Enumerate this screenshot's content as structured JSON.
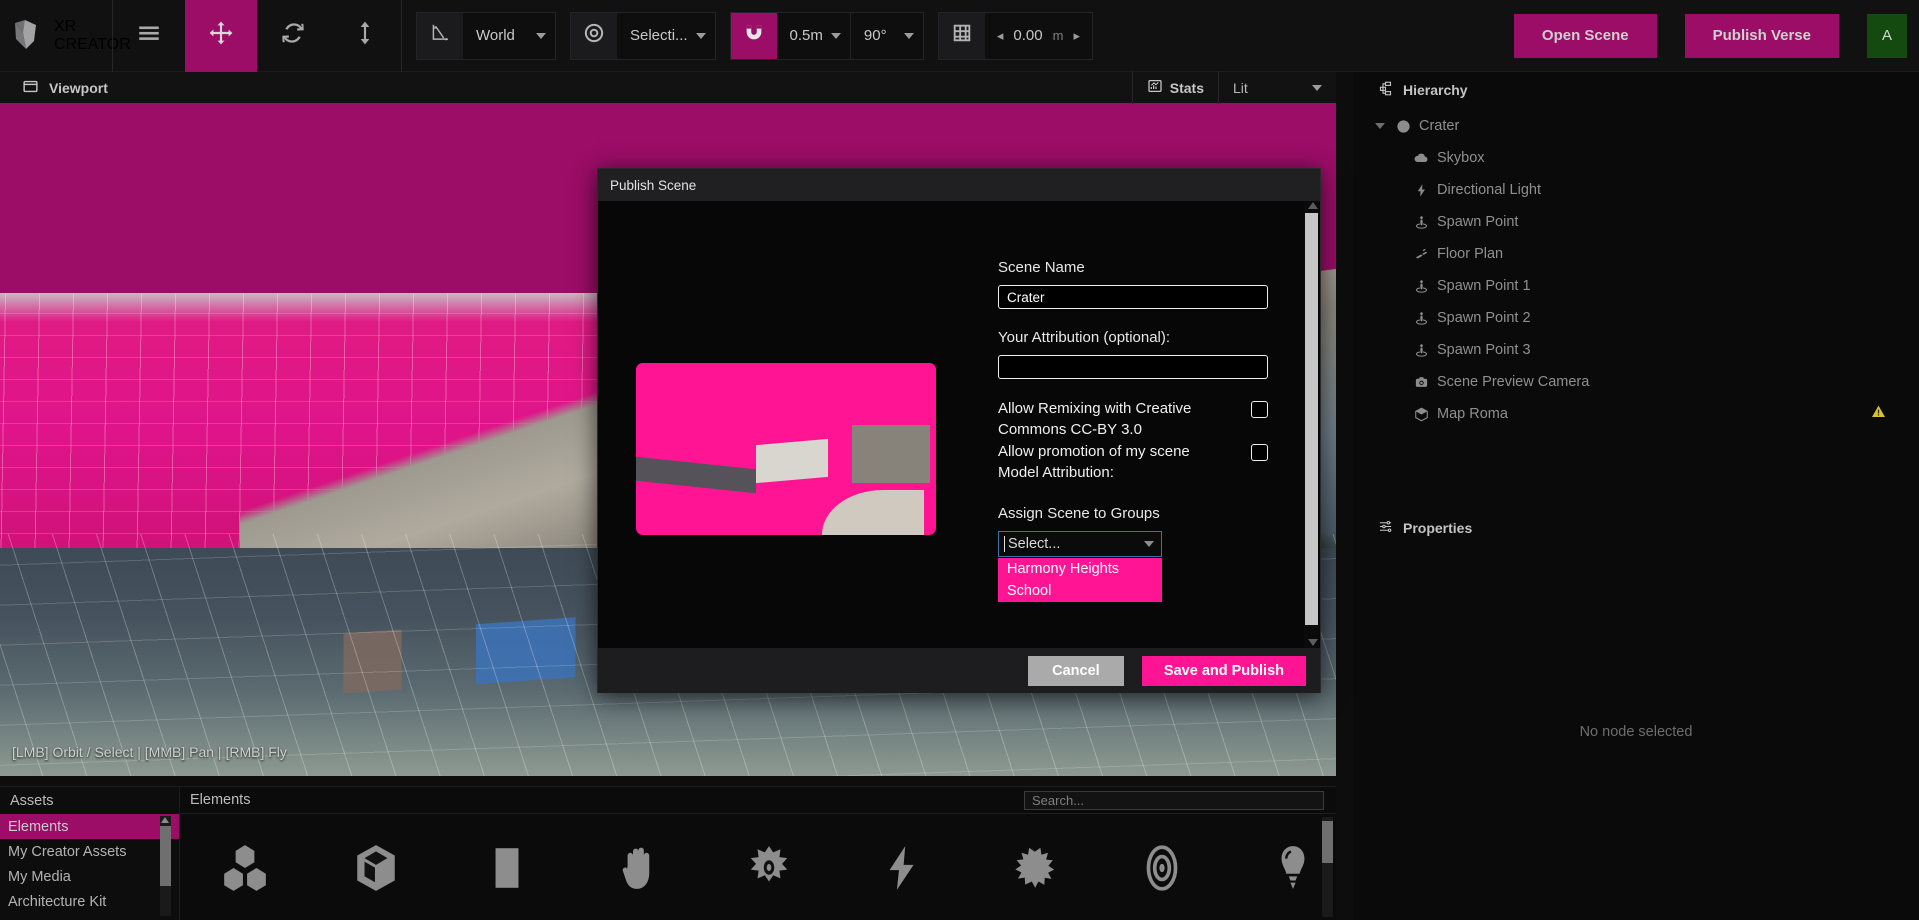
{
  "app": {
    "brand_line1": "XR",
    "brand_line2": "CREATOR"
  },
  "toolbar": {
    "menu_icon": "hamburger-menu-icon",
    "move_icon": "move-tool-icon",
    "rotate_icon": "rotate-tool-icon",
    "scale_icon": "scale-tool-icon",
    "space_icon": "axis-icon",
    "space_value": "World",
    "pivot_icon": "pivot-target-icon",
    "pivot_value": "Selecti...",
    "snap_icon": "magnet-icon",
    "snap_distance": "0.5m",
    "snap_angle": "90°",
    "grid_icon": "grid-icon",
    "grid_value": "0.00",
    "grid_unit": "m",
    "grid_prev": "◂",
    "grid_next": "▸",
    "open_scene_label": "Open Scene",
    "publish_verse_label": "Publish Verse",
    "avatar_initial": "A"
  },
  "viewport": {
    "panel_icon": "window-icon",
    "title": "Viewport",
    "stats_icon": "stats-chart-icon",
    "stats_label": "Stats",
    "shading_value": "Lit",
    "hint": "[LMB] Orbit / Select | [MMB] Pan | [RMB] Fly"
  },
  "hierarchy": {
    "panel_icon": "hierarchy-icon",
    "title": "Hierarchy",
    "items": [
      {
        "label": "Crater",
        "icon": "globe-icon",
        "depth": 0,
        "expanded": true,
        "warning": false
      },
      {
        "label": "Skybox",
        "icon": "cloud-icon",
        "depth": 1,
        "expanded": false,
        "warning": false
      },
      {
        "label": "Directional Light",
        "icon": "bolt-icon",
        "depth": 1,
        "expanded": false,
        "warning": false
      },
      {
        "label": "Spawn Point",
        "icon": "spawn-point-icon",
        "depth": 1,
        "expanded": false,
        "warning": false
      },
      {
        "label": "Floor Plan",
        "icon": "floor-plan-icon",
        "depth": 1,
        "expanded": false,
        "warning": false
      },
      {
        "label": "Spawn Point 1",
        "icon": "spawn-point-icon",
        "depth": 1,
        "expanded": false,
        "warning": false
      },
      {
        "label": "Spawn Point 2",
        "icon": "spawn-point-icon",
        "depth": 1,
        "expanded": false,
        "warning": false
      },
      {
        "label": "Spawn Point 3",
        "icon": "spawn-point-icon",
        "depth": 1,
        "expanded": false,
        "warning": false
      },
      {
        "label": "Scene Preview Camera",
        "icon": "camera-icon",
        "depth": 1,
        "expanded": false,
        "warning": false
      },
      {
        "label": "Map Roma",
        "icon": "cube-icon",
        "depth": 1,
        "expanded": false,
        "warning": true
      }
    ]
  },
  "properties": {
    "panel_icon": "sliders-icon",
    "title": "Properties",
    "empty_text": "No node selected"
  },
  "assets": {
    "left_header": "Assets",
    "categories": [
      {
        "label": "Elements",
        "selected": true
      },
      {
        "label": "My Creator Assets",
        "selected": false
      },
      {
        "label": "My Media",
        "selected": false
      },
      {
        "label": "Architecture Kit",
        "selected": false
      }
    ],
    "right_header": "Elements",
    "search_placeholder": "Search...",
    "search_value": "",
    "icons": [
      "blocks-icon",
      "cube-icon",
      "plane-icon",
      "hand-icon",
      "sun-icon",
      "bolt-icon",
      "particles-icon",
      "target-icon",
      "light-bulb-icon"
    ]
  },
  "modal": {
    "title": "Publish Scene",
    "scene_name_label": "Scene Name",
    "scene_name_value": "Crater",
    "attribution_label": "Your Attribution (optional):",
    "attribution_value": "",
    "remix_label": "Allow Remixing  with Creative Commons  CC-BY 3.0",
    "remix_checked": false,
    "promo_label": "Allow promotion of my scene",
    "promo_checked": false,
    "model_attribution_label": "Model Attribution:",
    "groups_label": "Assign Scene to Groups",
    "groups_select_value": "Select...",
    "groups_options": [
      "Harmony Heights",
      "School"
    ],
    "cancel_label": "Cancel",
    "publish_label": "Save and Publish"
  },
  "colors": {
    "accent_magenta": "#9b0d67",
    "bright_pink": "#ff1493",
    "panel_bg": "#0a0a0a",
    "avatar_green": "#14490f",
    "warning_yellow": "#d6c135"
  }
}
